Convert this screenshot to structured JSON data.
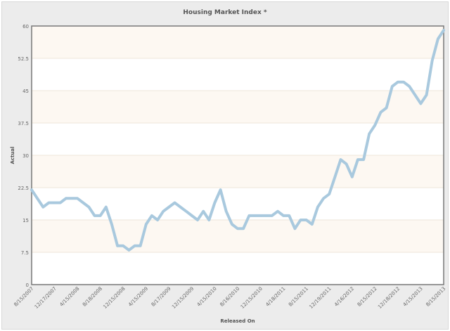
{
  "chart_data": {
    "type": "line",
    "title": "Housing Market Index *",
    "xlabel": "Released On",
    "ylabel": "Actual",
    "ylim": [
      0,
      60
    ],
    "yticks": [
      0,
      7.5,
      15,
      22.5,
      30,
      37.5,
      45,
      52.5,
      60
    ],
    "ytick_labels": [
      "0",
      "7.5",
      "15",
      "22.5",
      "30",
      "37.5",
      "45",
      "52.5",
      "60"
    ],
    "xtick_labels": [
      "8/15/2007",
      "12/17/2007",
      "4/15/2008",
      "8/18/2008",
      "12/15/2008",
      "4/15/2009",
      "8/17/2009",
      "12/15/2009",
      "4/15/2010",
      "8/16/2010",
      "12/15/2010",
      "4/18/2011",
      "8/15/2011",
      "12/19/2011",
      "4/16/2012",
      "8/15/2012",
      "12/18/2012",
      "4/15/2013",
      "8/15/2013"
    ],
    "grid": true,
    "series": [
      {
        "name": "Actual",
        "color": "#a9c9de",
        "values": [
          22,
          20,
          18,
          19,
          19,
          19,
          20,
          20,
          20,
          19,
          18,
          16,
          16,
          18,
          14,
          9,
          9,
          8,
          9,
          9,
          14,
          16,
          15,
          17,
          18,
          19,
          18,
          17,
          16,
          15,
          17,
          15,
          19,
          22,
          17,
          14,
          13,
          13,
          16,
          16,
          16,
          16,
          16,
          17,
          16,
          16,
          13,
          15,
          15,
          14,
          18,
          20,
          21,
          25,
          29,
          28,
          25,
          29,
          29,
          35,
          37,
          40,
          41,
          46,
          47,
          47,
          46,
          44,
          42,
          44,
          52,
          57,
          59
        ]
      }
    ]
  }
}
